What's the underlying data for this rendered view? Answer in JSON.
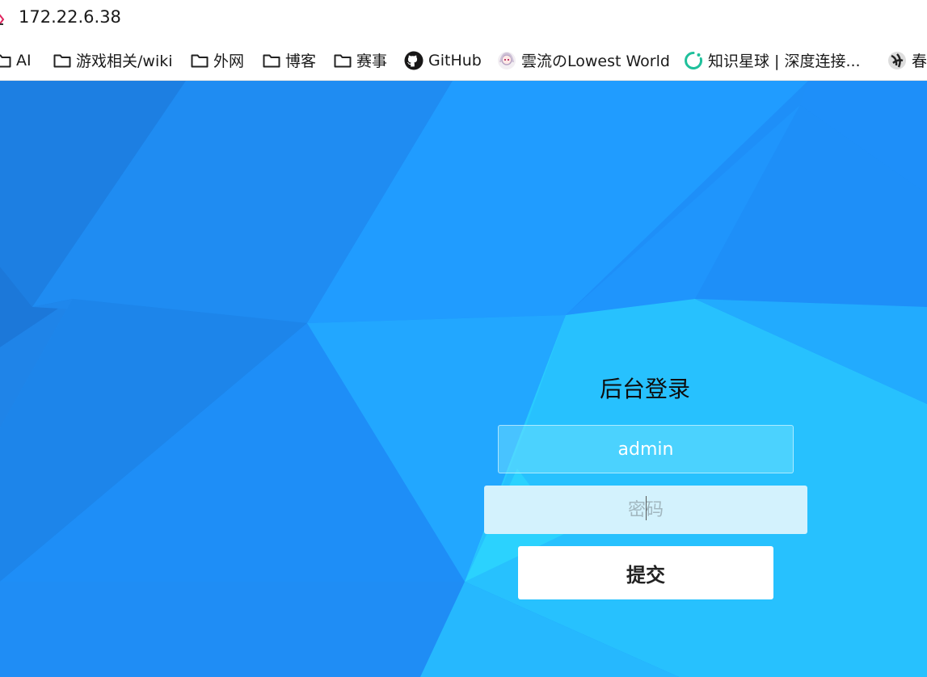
{
  "address_bar": {
    "url": "172.22.6.38"
  },
  "bookmarks": [
    {
      "label": "AI",
      "icon": "folder-icon"
    },
    {
      "label": "游戏相关/wiki",
      "icon": "folder-icon"
    },
    {
      "label": "外网",
      "icon": "folder-icon"
    },
    {
      "label": "博客",
      "icon": "folder-icon"
    },
    {
      "label": "赛事",
      "icon": "folder-icon"
    },
    {
      "label": "GitHub",
      "icon": "github-icon"
    },
    {
      "label": "雲流のLowest World",
      "icon": "avatar-icon"
    },
    {
      "label": "知识星球 | 深度连接...",
      "icon": "zsxq-icon"
    },
    {
      "label": "春",
      "icon": "site-icon"
    }
  ],
  "login": {
    "title": "后台登录",
    "username_value": "admin",
    "password_placeholder": "密码",
    "submit_label": "提交"
  },
  "colors": {
    "background_blue": "#1e8ff8",
    "background_cyan": "#28c8fe",
    "input_fill": "#5fd9ff",
    "password_fill": "#d3f2fd"
  }
}
